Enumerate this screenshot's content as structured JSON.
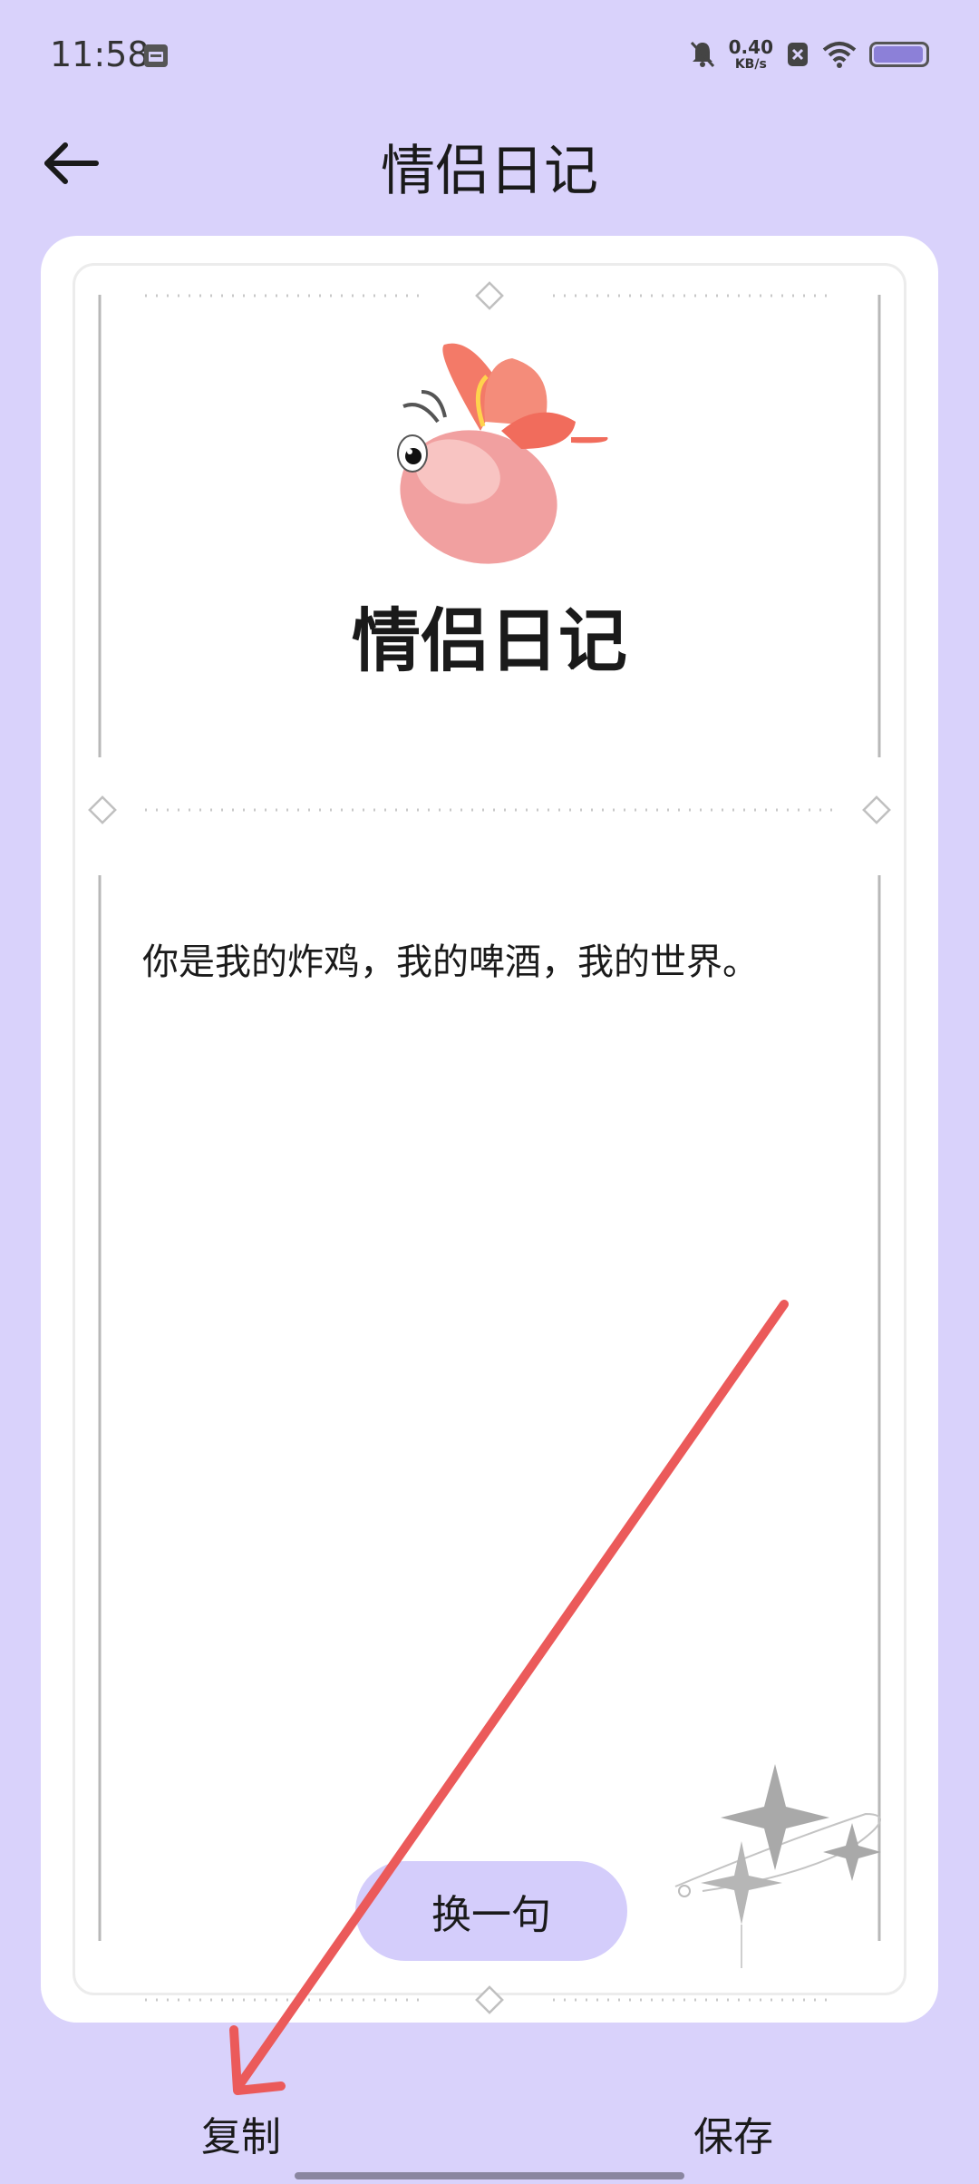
{
  "status_bar": {
    "time": "11:58",
    "net_speed": "0.40",
    "net_unit": "KB/s"
  },
  "header": {
    "title": "情侣日记"
  },
  "card": {
    "title": "情侣日记",
    "quote": "你是我的炸鸡，我的啤酒，我的世界。",
    "change_button": "换一句"
  },
  "actions": {
    "copy": "复制",
    "save": "保存"
  },
  "colors": {
    "background": "#d9d2fb",
    "button": "#d4cdfb",
    "arrow": "#eb5a5a"
  }
}
